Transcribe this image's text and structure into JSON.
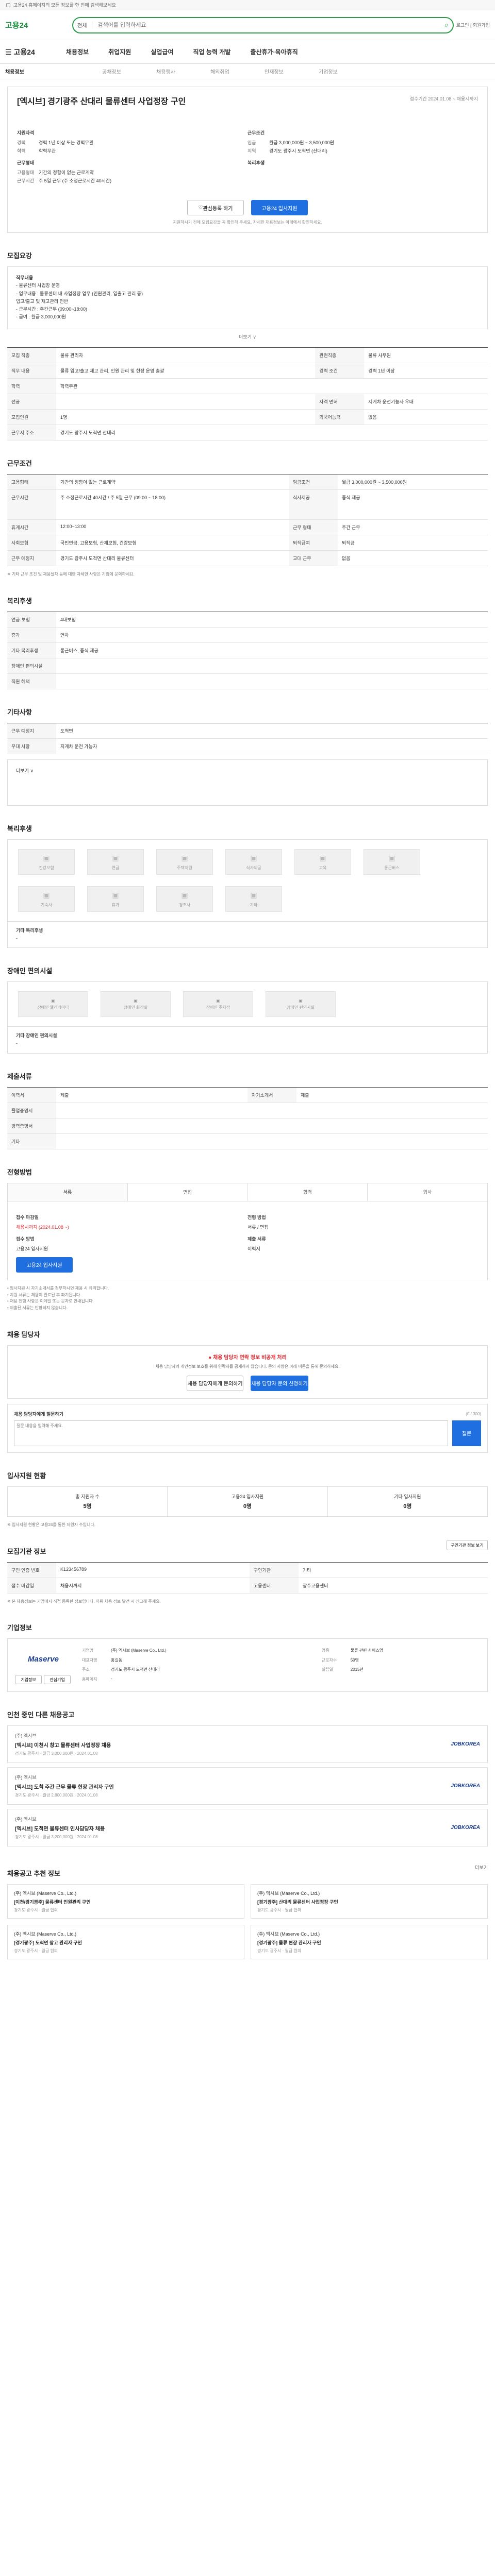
{
  "topbar": {
    "text": "고용24 홈페이지의 모든 정보를 한 번에 검색해보세요"
  },
  "header": {
    "logo": "고용24",
    "search_scope": "전체",
    "search_placeholder": "검색어를 입력하세요",
    "login": "로그인 | 회원가입"
  },
  "gnb": {
    "menu": "고용24",
    "items": [
      "채용정보",
      "취업지원",
      "실업급여",
      "직업 능력 개발",
      "출산휴가·육아휴직"
    ]
  },
  "breadcrumb": {
    "active": "채용정보",
    "items": [
      "공채정보",
      "채용행사",
      "해외취업",
      "인재정보",
      "기업정보"
    ]
  },
  "job": {
    "title": "[엑시브] 경기광주 산대리 물류센터 사업정장 구인",
    "period": "접수기간 2024.01.08 ~ 채용시까지",
    "left_label": "지원자격",
    "left": [
      {
        "k": "경력",
        "v": "경력 1년 이상 또는 경력무관"
      },
      {
        "k": "학력",
        "v": "학력무관"
      }
    ],
    "left_label2": "근무형태",
    "left2": [
      {
        "k": "고용형태",
        "v": "기간의 정함이 없는 근로계약"
      },
      {
        "k": "근무시간",
        "v": "주 5일 근무 (주 소정근로시간 40시간)"
      }
    ],
    "right_label": "근무조건",
    "right": [
      {
        "k": "임금",
        "v": "월급 3,000,000원 ~ 3,500,000원"
      },
      {
        "k": "지역",
        "v": "경기도 광주시 도척면 (산대리)"
      }
    ],
    "right_label2": "복리후생",
    "right2": [
      {
        "k": "",
        "v": ""
      }
    ],
    "btn_scrap": "관심등록 하기",
    "btn_apply": "고용24 입사지원",
    "note": "지원하시기 전에 모집요강을 꼭 확인해 주세요. 자세한 채용정보는 아래에서 확인하세요."
  },
  "recruit": {
    "title": "모집요강",
    "box": [
      "직무내용",
      "- 물류센터 사업장 운영",
      "- 업무내용 : 물류센터 내 사업정장 업무 (인원관리, 입출고 관리 등)",
      "  입고/출고 및 재고관리 전반",
      "- 근무시간 : 주간근무 (09:00~18:00)",
      "- 급여 : 월급 3,000,000원"
    ],
    "more": "더보기 ∨",
    "rows": [
      [
        "모집 직종",
        "물류 관리자",
        "관련직종",
        "물류 사무원"
      ],
      [
        "직무 내용",
        "물류 입고/출고 재고 관리, 인원 관리 및 현장 운영 총괄",
        "경력 조건",
        "경력 1년 이상"
      ],
      [
        "학력",
        "학력무관",
        "",
        ""
      ],
      [
        "전공",
        "",
        "자격 면허",
        "지게차 운전기능사 우대"
      ],
      [
        "모집인원",
        "1명",
        "외국어능력",
        "없음"
      ],
      [
        "근무지 주소",
        "경기도 광주시 도척면 산대리",
        "",
        ""
      ]
    ]
  },
  "cond": {
    "title": "근무조건",
    "rows": [
      [
        "고용형태",
        "기간의 정함이 없는 근로계약",
        "임금조건",
        "월급 3,000,000원 ~ 3,500,000원"
      ],
      [
        "근무시간",
        "주 소정근로시간 40시간 / 주 5일 근무 (09:00 ~ 18:00)",
        "식사제공",
        "중식 제공"
      ],
      [
        "휴게시간",
        "12:00~13:00",
        "근무 형태",
        "주간 근무"
      ],
      [
        "사회보험",
        "국민연금, 고용보험, 산재보험, 건강보험",
        "퇴직급여",
        "퇴직금"
      ],
      [
        "근무 예정지",
        "경기도 광주시 도척면 산대리 물류센터",
        "교대 근무",
        "없음"
      ]
    ],
    "foot": "※ 기타 근무 조건 및 채용절차 등에 대한 자세한 사항은 기업에 문의하세요."
  },
  "welfare": {
    "title": "복리후생",
    "rows": [
      [
        "연금·보험",
        "4대보험"
      ],
      [
        "휴가",
        "연차"
      ],
      [
        "기타 복리후생",
        "통근버스, 중식 제공"
      ],
      [
        "장애인 편의시설",
        ""
      ],
      [
        "직원 혜택",
        ""
      ]
    ]
  },
  "etc": {
    "title": "기타사항",
    "rows": [
      [
        "근무 예정지",
        "도척면"
      ],
      [
        "우대 사항",
        "지게차 운전 가능자"
      ]
    ],
    "more": "더보기 ∨"
  },
  "benefit": {
    "title": "복리후생",
    "items": [
      "건강보험",
      "연금",
      "주택지원",
      "식사제공",
      "교육",
      "통근버스",
      "기숙사",
      "휴가",
      "경조사",
      "기타"
    ],
    "extra_label": "기타 복리후생",
    "extra": "-"
  },
  "disabled": {
    "title": "장애인 편의시설",
    "items": [
      "장애인 엘리베이터",
      "장애인 화장실",
      "장애인 주차장",
      "장애인 편의시설"
    ],
    "extra_label": "기타 장애인 편의시설",
    "extra": "-"
  },
  "doc": {
    "title": "제출서류",
    "rows": [
      [
        "이력서",
        "제출",
        "자기소개서",
        "제출"
      ],
      [
        "졸업증명서",
        ""
      ],
      [
        "경력증명서",
        ""
      ],
      [
        "기타",
        ""
      ]
    ]
  },
  "proc": {
    "title": "전형방법",
    "steps": [
      "서류",
      "면접",
      "합격",
      "입사"
    ],
    "l1": "접수 마감일",
    "l1v": "채용시까지 (2024.01.08 ~)",
    "l2": "전형 방법",
    "l2v": "서류 / 면접",
    "l3": "접수 방법",
    "l3v": "고용24 입사지원",
    "l4": "제출 서류",
    "l4v": "이력서",
    "btn": "고용24 입사지원",
    "bullets": [
      "• 입사지원 시 자기소개서를 첨부하시면 채용 시 유리합니다.",
      "• 지원 서류는 채용이 완료된 후 파기됩니다.",
      "• 채용 진행 사항은 이메일 또는 문자로 안내됩니다.",
      "• 제출된 서류는 반환되지 않습니다."
    ]
  },
  "contact": {
    "title": "채용 담당자",
    "alert_t": "● 채용 담당자 연락 정보 비공개 처리",
    "alert_s": "채용 담당자의 개인정보 보호를 위해 연락처를 공개하지 않습니다. 문의 사항은 아래 버튼을 통해 문의하세요.",
    "btn1": "채용 담당자에게 문의하기",
    "btn2": "채용 담당자 문의 신청하기",
    "q_title": "채용 담당자에게 질문하기",
    "q_count": "(0 / 300)",
    "q_placeholder": "질문 내용을 입력해 주세요.",
    "q_send": "질문"
  },
  "stats": {
    "title": "입사지원 현황",
    "cells": [
      {
        "k": "총 지원자 수",
        "v": "5명"
      },
      {
        "k": "고용24 입사지원",
        "v": "0명"
      },
      {
        "k": "기타 입사지원",
        "v": "0명"
      }
    ],
    "note": "※ 입사지원 현황은 고용24를 통한 지원자 수입니다."
  },
  "info": {
    "title": "모집기관 정보",
    "btn": "구인기관 정보 보기",
    "rows": [
      [
        "구인 인증 번호",
        "K123456789",
        "구인기관",
        "기타"
      ],
      [
        "접수 마감일",
        "채용시까지",
        "고용센터",
        "광주고용센터"
      ]
    ],
    "note": "※ 본 채용정보는 기업에서 직접 등록한 정보입니다. 허위 채용 정보 발견 시 신고해 주세요."
  },
  "company": {
    "title": "기업정보",
    "logo": "Maserve",
    "btn1": "기업정보",
    "btn2": "관심기업",
    "rows": [
      [
        "기업명",
        "(주) 엑시브 (Maserve Co., Ltd.)",
        "업종",
        "물류 관련 서비스업"
      ],
      [
        "대표자명",
        "홍길동",
        "근로자수",
        "50명"
      ],
      [
        "주소",
        "경기도 광주시 도척면 산대리",
        "설립일",
        "2015년"
      ],
      [
        "홈페이지",
        "-",
        "",
        ""
      ]
    ]
  },
  "related": {
    "title": "인천 중인 다른 채용공고",
    "items": [
      {
        "a": "(주) 엑시브",
        "t": "[엑시브] 이천시 창고 물류센터 사업정장 채용",
        "m": "경기도 광주시 · 월급 3,000,000원 · 2024.01.08"
      },
      {
        "a": "(주) 엑시브",
        "t": "[엑시브] 도척 주간 근무 물류 현장 관리자 구인",
        "m": "경기도 광주시 · 월급 2,800,000원 · 2024.01.08"
      },
      {
        "a": "(주) 엑시브",
        "t": "[엑시브] 도척면 물류센터 인사담당자 채용",
        "m": "경기도 광주시 · 월급 3,200,000원 · 2024.01.08"
      }
    ],
    "badge": "JOBKOREA"
  },
  "recommend": {
    "title": "채용공고 추천 정보",
    "more": "더보기",
    "items": [
      {
        "a": "(주) 엑시브 (Maserve Co., Ltd.)",
        "t": "[이천/경기광주] 물류센터 인원관리 구인",
        "m": "경기도 광주시 · 월급 협의"
      },
      {
        "a": "(주) 엑시브 (Maserve Co., Ltd.)",
        "t": "[경기광주] 산대리 물류센터 사업정장 구인",
        "m": "경기도 광주시 · 월급 협의"
      },
      {
        "a": "(주) 엑시브 (Maserve Co., Ltd.)",
        "t": "[경기광주] 도척면 창고 관리자 구인",
        "m": "경기도 광주시 · 월급 협의"
      },
      {
        "a": "(주) 엑시브 (Maserve Co., Ltd.)",
        "t": "[경기광주] 물류 현장 관리자 구인",
        "m": "경기도 광주시 · 월급 협의"
      }
    ]
  }
}
